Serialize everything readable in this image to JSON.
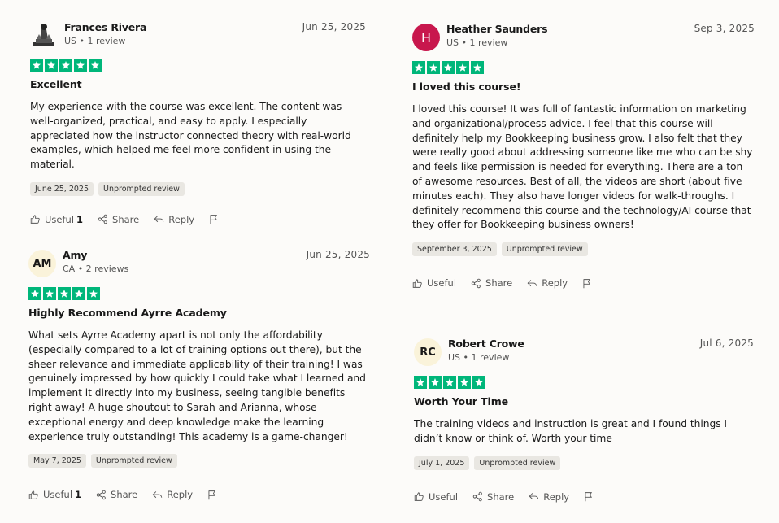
{
  "reviews": [
    {
      "name": "Frances Rivera",
      "meta": "US • 1 review",
      "date": "Jun 25, 2025",
      "title": "Excellent",
      "body": "My experience with the course was excellent. The content was well-organized, practical, and easy to apply. I especially appreciated how the instructor connected theory with real-world examples, which helped me feel more confident in using the material.",
      "experience_date": "June 25, 2025",
      "tag": "Unprompted review",
      "useful_label": "Useful",
      "useful_count": "1",
      "share_label": "Share",
      "reply_label": "Reply",
      "rating": 5,
      "avatar": "monument-icon"
    },
    {
      "name": "Amy",
      "meta": "CA • 2 reviews",
      "date": "Jun 25, 2025",
      "initials": "AM",
      "title": "Highly Recommend Ayrre Academy",
      "body": "What sets Ayrre Academy apart is not only the affordability (especially compared to a lot of training options out there), but the sheer relevance and immediate applicability of their training! I was genuinely impressed by how quickly I could take what I learned and implement it directly into my business, seeing tangible benefits right away! A huge shoutout to Sarah and Arianna, whose exceptional energy and deep knowledge make the learning experience truly outstanding! This academy is a game-changer!",
      "experience_date": "May 7, 2025",
      "tag": "Unprompted review",
      "useful_label": "Useful",
      "useful_count": "1",
      "share_label": "Share",
      "reply_label": "Reply",
      "rating": 5
    },
    {
      "name": "Heather Saunders",
      "meta": "US • 1 review",
      "date": "Sep 3, 2025",
      "initials": "H",
      "title": "I loved this course!",
      "body": "I loved this course! It was full of fantastic information on marketing and organizational/process advice. I feel that this course will definitely help my Bookkeeping business grow. I also felt that they were really good about addressing someone like me who can be shy and feels like permission is needed for everything. There are a ton of awesome resources. Best of all, the videos are short (about five minutes each). They also have longer videos for walk-throughs. I definitely recommend this course and the technology/AI course that they offer for Bookkeeping business owners!",
      "experience_date": "September 3, 2025",
      "tag": "Unprompted review",
      "useful_label": "Useful",
      "share_label": "Share",
      "reply_label": "Reply",
      "rating": 5,
      "avatar_color": "#c8174d"
    },
    {
      "name": "Robert Crowe",
      "meta": "US • 1 review",
      "date": "Jul 6, 2025",
      "initials": "RC",
      "title": "Worth Your Time",
      "body": "The training videos and instruction is great and I found things I didn’t know or think of. Worth your time",
      "experience_date": "July 1, 2025",
      "tag": "Unprompted review",
      "useful_label": "Useful",
      "share_label": "Share",
      "reply_label": "Reply",
      "rating": 5
    }
  ],
  "colors": {
    "star_green": "#00b67a",
    "tag_bg": "#e9e7e2",
    "initials_bg": "#faf3da"
  }
}
